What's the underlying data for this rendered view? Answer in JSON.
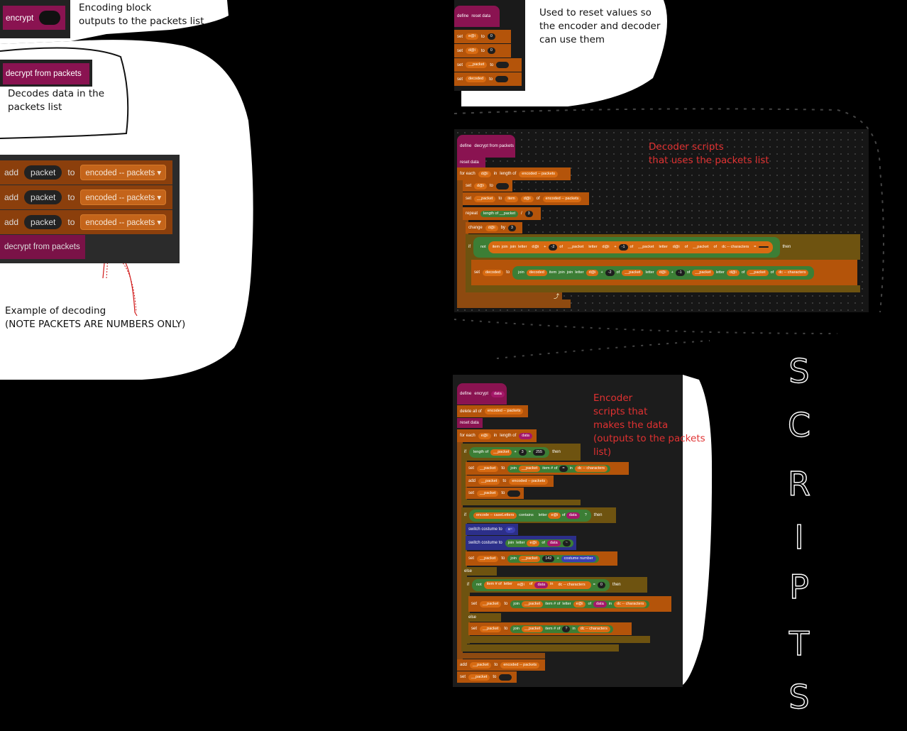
{
  "notes": {
    "encode_block": "Encoding block\noutputs to the packets list",
    "decode_block": "Decodes data in the\npackets list",
    "decode_example": "Example of decoding\n(NOTE PACKETS ARE NUMBERS ONLY)",
    "reset_data": "Used to reset values so\nthe encoder and decoder\ncan use them",
    "decoder_scripts": "Decoder scripts\nthat uses the packets list",
    "encoder_scripts": "Encoder\nscripts that\nmakes the data\n(outputs to the packets\nlist)"
  },
  "scripts_label": [
    "S",
    "C",
    "R",
    "I",
    "P",
    "T",
    "S"
  ],
  "blocks": {
    "encrypt": "encrypt",
    "decrypt_from_packets": "decrypt from packets",
    "add": "add",
    "packet": "packet",
    "to": "to",
    "encoded_packets": "encoded -- packets",
    "dropdown_arrow": "▾"
  },
  "reset_script": {
    "define": "define",
    "name": "reset data",
    "rows": [
      {
        "set": "set",
        "var": "e@i",
        "to": "to",
        "val": "0"
      },
      {
        "set": "set",
        "var": "d@i",
        "to": "to",
        "val": "0"
      },
      {
        "set": "set",
        "var": "__packet",
        "to": "to",
        "val": ""
      },
      {
        "set": "set",
        "var": "decoded",
        "to": "to",
        "val": ""
      }
    ]
  },
  "decoder_script": {
    "define": "define",
    "name": "decrypt from packets",
    "reset": "reset data",
    "for_each": "for each",
    "var": "d@i",
    "in": "in",
    "length_of": "length of",
    "list": "encoded -- packets",
    "set": "set",
    "to": "to",
    "packet_var": "__packet",
    "item": "item",
    "of": "of",
    "repeat": "repeat",
    "div": "/",
    "three": "3",
    "change": "change",
    "by": "by",
    "if": "if",
    "not": "not",
    "join": "join",
    "letter": "letter",
    "plus": "+",
    "minus2": "-2",
    "minus1": "-1",
    "dc_chars": "dc -- characters",
    "eq": "=",
    "then": "then",
    "decoded": "decoded",
    "arrow": "⤴"
  },
  "encoder_script": {
    "define": "define",
    "name": "encrypt",
    "arg": "data",
    "delete_all": "delete all of",
    "list": "encoded -- packets",
    "reset": "reset data",
    "for_each": "for each",
    "var": "e@i",
    "in": "in",
    "length_of": "length of",
    "if": "if",
    "packet_var": "__packet",
    "plus": "+",
    "three": "3",
    "eq": "=",
    "n255": "255",
    "then": "then",
    "set": "set",
    "to": "to",
    "join": "join",
    "item_no": "item # of",
    "dc_chars": "dc -- characters",
    "add": "add",
    "contains": "contains",
    "letter": "letter",
    "of": "of",
    "question": "?",
    "lower": "encode -- caseLetters",
    "switch_costume": "switch costume to",
    "costume_a": "a~",
    "tilde": "~",
    "n142": "142",
    "costume": "costume",
    "number": "number",
    "else": "else",
    "not": "not",
    "zero": "0"
  }
}
